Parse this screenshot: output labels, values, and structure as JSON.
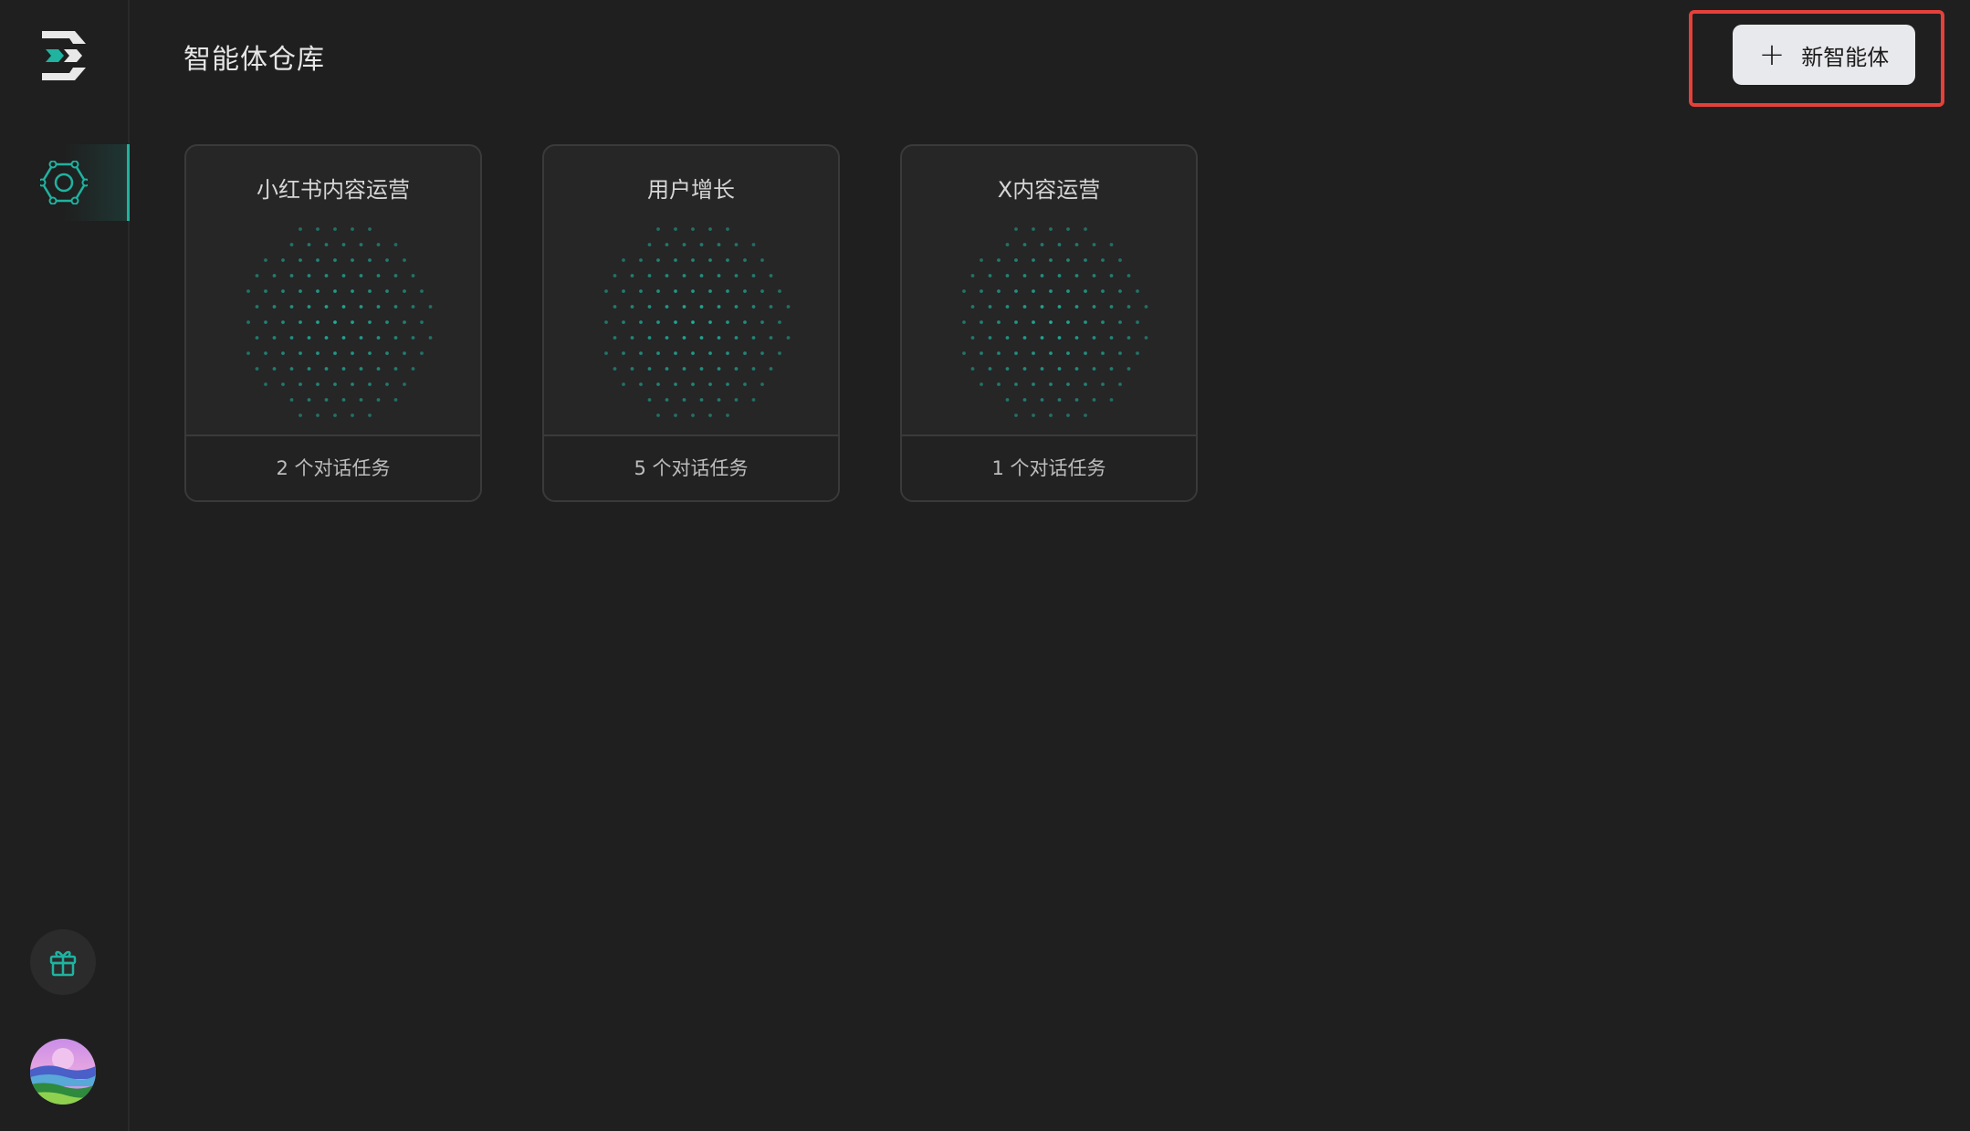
{
  "app": {
    "title": "智能体仓库",
    "accent_color": "#1fb3a0",
    "highlight_color": "#e5403a"
  },
  "sidebar": {
    "logo_icon": "app-logo-icon",
    "items": [
      {
        "name": "agents",
        "icon": "hexagon-network-icon",
        "active": true
      }
    ],
    "gift_icon": "gift-icon",
    "avatar": "user-avatar"
  },
  "header": {
    "new_agent_button": {
      "icon": "plus-icon",
      "plus": "+",
      "label": "新智能体"
    }
  },
  "agents": [
    {
      "name": "小红书内容运营",
      "tasks": "2 个对话任务"
    },
    {
      "name": "用户增长",
      "tasks": "5 个对话任务"
    },
    {
      "name": "X内容运营",
      "tasks": "1 个对话任务"
    }
  ]
}
